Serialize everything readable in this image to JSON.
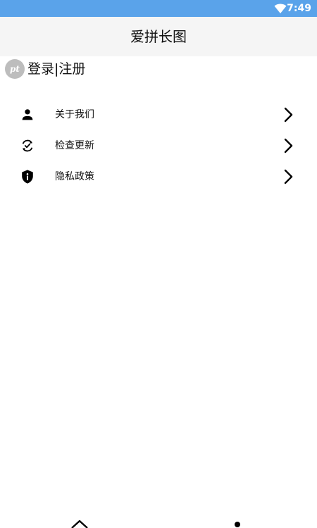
{
  "status_bar": {
    "time": "7:49",
    "icons": [
      "wifi-icon"
    ]
  },
  "app_bar": {
    "title": "爱拼长图"
  },
  "profile": {
    "avatar_text": "pt",
    "login_label": "登录|注册"
  },
  "menu": {
    "items": [
      {
        "label": "关于我们",
        "icon": "person-icon"
      },
      {
        "label": "检查更新",
        "icon": "refresh-check-icon"
      },
      {
        "label": "隐私政策",
        "icon": "shield-info-icon"
      }
    ]
  },
  "bottom_nav": {
    "icons": [
      "home-icon",
      "profile-icon"
    ]
  },
  "colors": {
    "status_bar": "#5aa3ea",
    "app_bar": "#f5f5f5",
    "avatar": "#bdbdbd",
    "text": "#111111"
  }
}
